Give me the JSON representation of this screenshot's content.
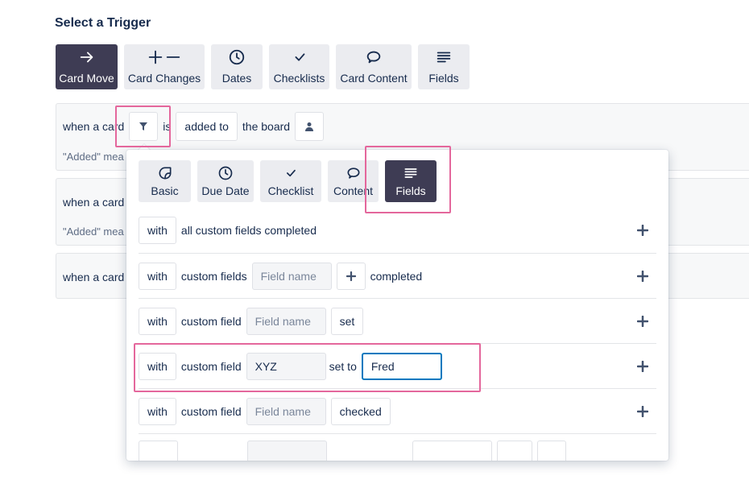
{
  "heading": "Select a Trigger",
  "trigger_tabs": [
    {
      "label": "Card Move",
      "icon": "arrow-right-icon",
      "active": true
    },
    {
      "label": "Card Changes",
      "icon": "plus-minus-icon",
      "active": false
    },
    {
      "label": "Dates",
      "icon": "clock-icon",
      "active": false
    },
    {
      "label": "Checklists",
      "icon": "checkmark-icon",
      "active": false
    },
    {
      "label": "Card Content",
      "icon": "speech-bubble-icon",
      "active": false
    },
    {
      "label": "Fields",
      "icon": "lines-icon",
      "active": false
    }
  ],
  "trigger_rows": [
    {
      "text": "when a card",
      "is": "is",
      "action": "added to",
      "target": "the board",
      "hint": "\"Added\" mea"
    },
    {
      "text": "when a card",
      "hint": "\"Added\" mea"
    },
    {
      "text": "when a card"
    }
  ],
  "popover": {
    "tabs": [
      {
        "label": "Basic",
        "icon": "sticker-icon",
        "active": false
      },
      {
        "label": "Due Date",
        "icon": "clock-icon",
        "active": false
      },
      {
        "label": "Checklist",
        "icon": "checkmark-icon",
        "active": false
      },
      {
        "label": "Content",
        "icon": "speech-bubble-icon",
        "active": false
      },
      {
        "label": "Fields",
        "icon": "lines-icon",
        "active": true
      }
    ],
    "rows": {
      "r1": {
        "with": "with",
        "text": "all custom fields completed"
      },
      "r2": {
        "with": "with",
        "text": "custom fields",
        "field_placeholder": "Field name",
        "suffix": "completed"
      },
      "r3": {
        "with": "with",
        "text": "custom field",
        "field_placeholder": "Field name",
        "value": "set"
      },
      "r4": {
        "with": "with",
        "text": "custom field",
        "field_value": "XYZ",
        "mid": "set to",
        "value_input": "Fred"
      },
      "r5": {
        "with": "with",
        "text": "custom field",
        "field_placeholder": "Field name",
        "value": "checked"
      }
    }
  },
  "colors": {
    "active_tab": "#3e3c54",
    "highlight": "#e4679c",
    "focus": "#0079bf"
  }
}
